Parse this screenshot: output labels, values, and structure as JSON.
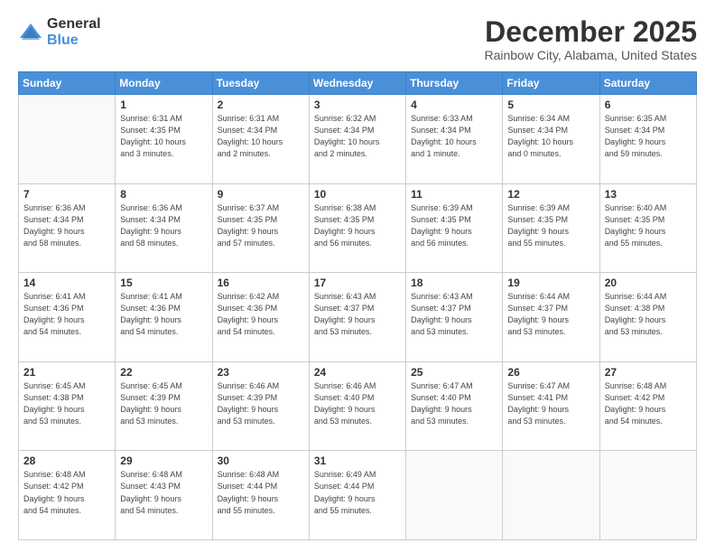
{
  "logo": {
    "general": "General",
    "blue": "Blue"
  },
  "header": {
    "month": "December 2025",
    "location": "Rainbow City, Alabama, United States"
  },
  "weekdays": [
    "Sunday",
    "Monday",
    "Tuesday",
    "Wednesday",
    "Thursday",
    "Friday",
    "Saturday"
  ],
  "weeks": [
    [
      {
        "day": "",
        "info": ""
      },
      {
        "day": "1",
        "info": "Sunrise: 6:31 AM\nSunset: 4:35 PM\nDaylight: 10 hours\nand 3 minutes."
      },
      {
        "day": "2",
        "info": "Sunrise: 6:31 AM\nSunset: 4:34 PM\nDaylight: 10 hours\nand 2 minutes."
      },
      {
        "day": "3",
        "info": "Sunrise: 6:32 AM\nSunset: 4:34 PM\nDaylight: 10 hours\nand 2 minutes."
      },
      {
        "day": "4",
        "info": "Sunrise: 6:33 AM\nSunset: 4:34 PM\nDaylight: 10 hours\nand 1 minute."
      },
      {
        "day": "5",
        "info": "Sunrise: 6:34 AM\nSunset: 4:34 PM\nDaylight: 10 hours\nand 0 minutes."
      },
      {
        "day": "6",
        "info": "Sunrise: 6:35 AM\nSunset: 4:34 PM\nDaylight: 9 hours\nand 59 minutes."
      }
    ],
    [
      {
        "day": "7",
        "info": "Sunrise: 6:36 AM\nSunset: 4:34 PM\nDaylight: 9 hours\nand 58 minutes."
      },
      {
        "day": "8",
        "info": "Sunrise: 6:36 AM\nSunset: 4:34 PM\nDaylight: 9 hours\nand 58 minutes."
      },
      {
        "day": "9",
        "info": "Sunrise: 6:37 AM\nSunset: 4:35 PM\nDaylight: 9 hours\nand 57 minutes."
      },
      {
        "day": "10",
        "info": "Sunrise: 6:38 AM\nSunset: 4:35 PM\nDaylight: 9 hours\nand 56 minutes."
      },
      {
        "day": "11",
        "info": "Sunrise: 6:39 AM\nSunset: 4:35 PM\nDaylight: 9 hours\nand 56 minutes."
      },
      {
        "day": "12",
        "info": "Sunrise: 6:39 AM\nSunset: 4:35 PM\nDaylight: 9 hours\nand 55 minutes."
      },
      {
        "day": "13",
        "info": "Sunrise: 6:40 AM\nSunset: 4:35 PM\nDaylight: 9 hours\nand 55 minutes."
      }
    ],
    [
      {
        "day": "14",
        "info": "Sunrise: 6:41 AM\nSunset: 4:36 PM\nDaylight: 9 hours\nand 54 minutes."
      },
      {
        "day": "15",
        "info": "Sunrise: 6:41 AM\nSunset: 4:36 PM\nDaylight: 9 hours\nand 54 minutes."
      },
      {
        "day": "16",
        "info": "Sunrise: 6:42 AM\nSunset: 4:36 PM\nDaylight: 9 hours\nand 54 minutes."
      },
      {
        "day": "17",
        "info": "Sunrise: 6:43 AM\nSunset: 4:37 PM\nDaylight: 9 hours\nand 53 minutes."
      },
      {
        "day": "18",
        "info": "Sunrise: 6:43 AM\nSunset: 4:37 PM\nDaylight: 9 hours\nand 53 minutes."
      },
      {
        "day": "19",
        "info": "Sunrise: 6:44 AM\nSunset: 4:37 PM\nDaylight: 9 hours\nand 53 minutes."
      },
      {
        "day": "20",
        "info": "Sunrise: 6:44 AM\nSunset: 4:38 PM\nDaylight: 9 hours\nand 53 minutes."
      }
    ],
    [
      {
        "day": "21",
        "info": "Sunrise: 6:45 AM\nSunset: 4:38 PM\nDaylight: 9 hours\nand 53 minutes."
      },
      {
        "day": "22",
        "info": "Sunrise: 6:45 AM\nSunset: 4:39 PM\nDaylight: 9 hours\nand 53 minutes."
      },
      {
        "day": "23",
        "info": "Sunrise: 6:46 AM\nSunset: 4:39 PM\nDaylight: 9 hours\nand 53 minutes."
      },
      {
        "day": "24",
        "info": "Sunrise: 6:46 AM\nSunset: 4:40 PM\nDaylight: 9 hours\nand 53 minutes."
      },
      {
        "day": "25",
        "info": "Sunrise: 6:47 AM\nSunset: 4:40 PM\nDaylight: 9 hours\nand 53 minutes."
      },
      {
        "day": "26",
        "info": "Sunrise: 6:47 AM\nSunset: 4:41 PM\nDaylight: 9 hours\nand 53 minutes."
      },
      {
        "day": "27",
        "info": "Sunrise: 6:48 AM\nSunset: 4:42 PM\nDaylight: 9 hours\nand 54 minutes."
      }
    ],
    [
      {
        "day": "28",
        "info": "Sunrise: 6:48 AM\nSunset: 4:42 PM\nDaylight: 9 hours\nand 54 minutes."
      },
      {
        "day": "29",
        "info": "Sunrise: 6:48 AM\nSunset: 4:43 PM\nDaylight: 9 hours\nand 54 minutes."
      },
      {
        "day": "30",
        "info": "Sunrise: 6:48 AM\nSunset: 4:44 PM\nDaylight: 9 hours\nand 55 minutes."
      },
      {
        "day": "31",
        "info": "Sunrise: 6:49 AM\nSunset: 4:44 PM\nDaylight: 9 hours\nand 55 minutes."
      },
      {
        "day": "",
        "info": ""
      },
      {
        "day": "",
        "info": ""
      },
      {
        "day": "",
        "info": ""
      }
    ]
  ]
}
